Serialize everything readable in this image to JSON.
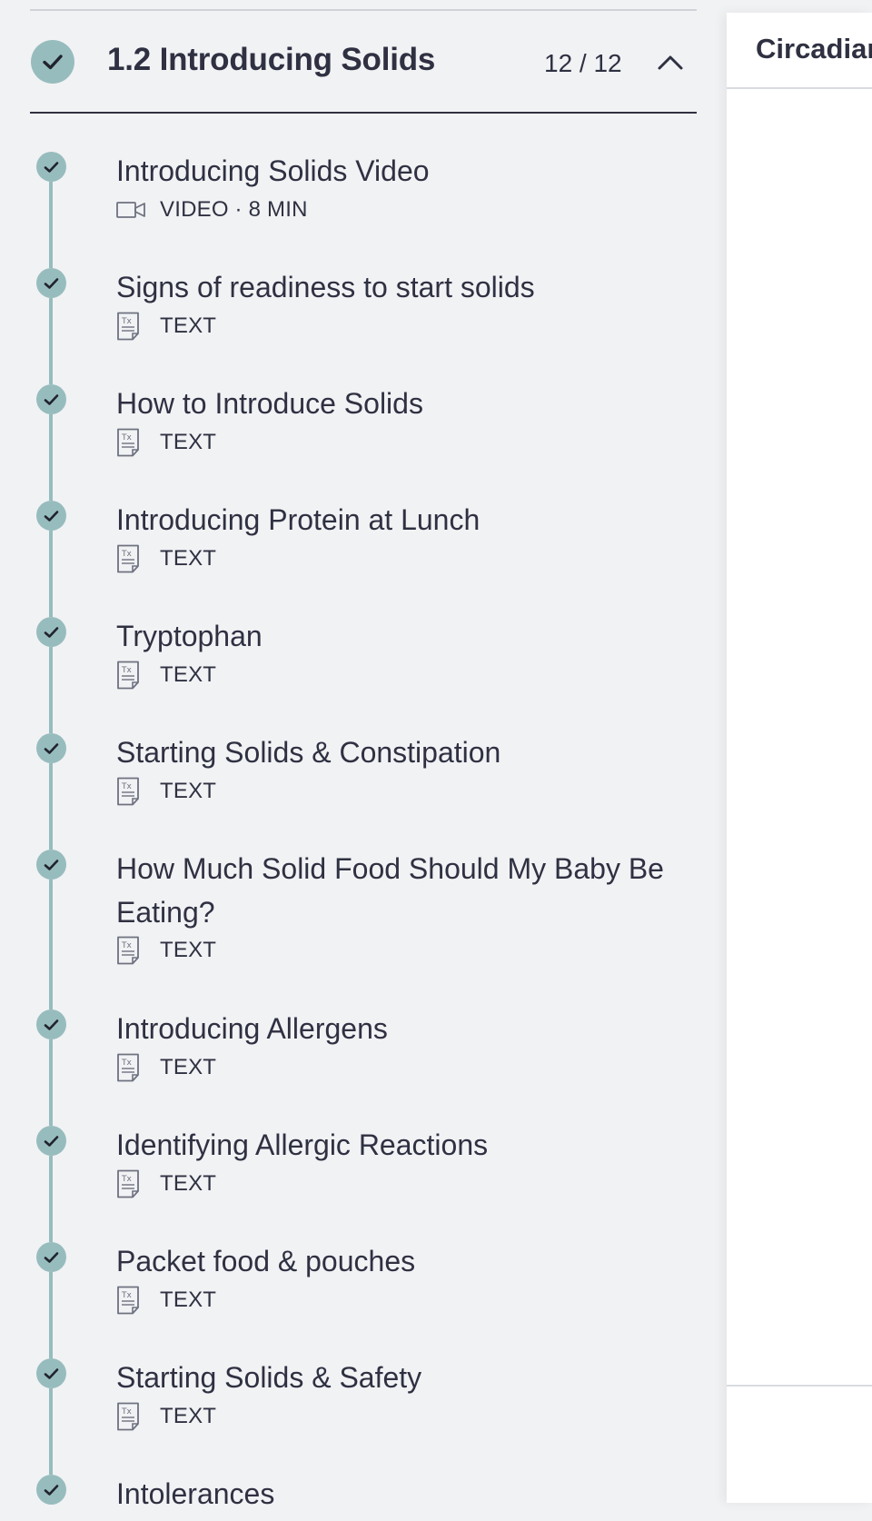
{
  "section": {
    "title": "1.2 Introducing Solids",
    "progress": "12 / 12",
    "check_icon": "check-icon",
    "toggle_icon": "chevron-up-icon"
  },
  "lessons": [
    {
      "title": "Introducing Solids Video",
      "type": "VIDEO · 8 MIN",
      "icon": "video-camera-icon"
    },
    {
      "title": "Signs of readiness to start solids",
      "type": "TEXT",
      "icon": "text-document-icon"
    },
    {
      "title": "How to Introduce Solids",
      "type": "TEXT",
      "icon": "text-document-icon"
    },
    {
      "title": "Introducing Protein at Lunch",
      "type": "TEXT",
      "icon": "text-document-icon"
    },
    {
      "title": "Tryptophan",
      "type": "TEXT",
      "icon": "text-document-icon"
    },
    {
      "title": "Starting Solids & Constipation",
      "type": "TEXT",
      "icon": "text-document-icon"
    },
    {
      "title": "How Much Solid Food Should My Baby Be Eating?",
      "type": "TEXT",
      "icon": "text-document-icon"
    },
    {
      "title": "Introducing Allergens",
      "type": "TEXT",
      "icon": "text-document-icon"
    },
    {
      "title": "Identifying Allergic Reactions",
      "type": "TEXT",
      "icon": "text-document-icon"
    },
    {
      "title": "Packet food & pouches",
      "type": "TEXT",
      "icon": "text-document-icon"
    },
    {
      "title": "Starting Solids & Safety",
      "type": "TEXT",
      "icon": "text-document-icon"
    },
    {
      "title": "Intolerances",
      "type": "",
      "icon": "text-document-icon"
    }
  ],
  "right_panel": {
    "title": "Circadian"
  },
  "colors": {
    "accent": "#97bcbd",
    "text": "#2f3142",
    "background": "#f1f2f4"
  }
}
